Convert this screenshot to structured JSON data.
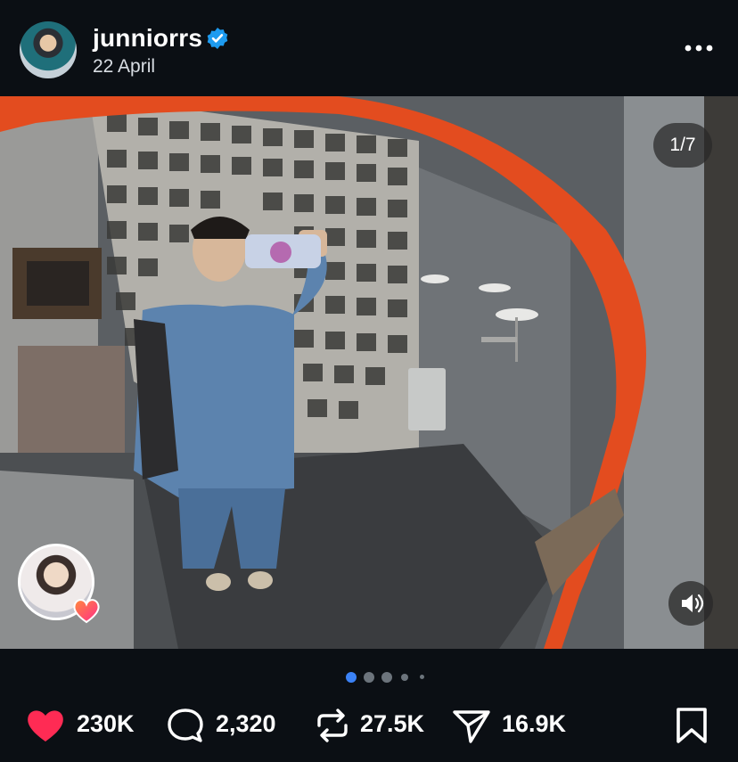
{
  "post": {
    "username": "junniorrs",
    "verified": true,
    "date": "22 April",
    "slide_counter": "1/7",
    "more_icon": "more-horizontal-icon",
    "slide_dots": {
      "total": 5,
      "active_index": 0
    }
  },
  "actions": {
    "likes": "230K",
    "comments": "2,320",
    "reposts": "27.5K",
    "shares": "16.9K",
    "icons": [
      "heart-icon",
      "comment-icon",
      "repost-icon",
      "share-icon",
      "bookmark-icon"
    ]
  },
  "colors": {
    "background": "#0b0f14",
    "verified_blue": "#1d9bf0",
    "like_red": "#ff2b54",
    "mirror_orange": "#e34c1f"
  }
}
